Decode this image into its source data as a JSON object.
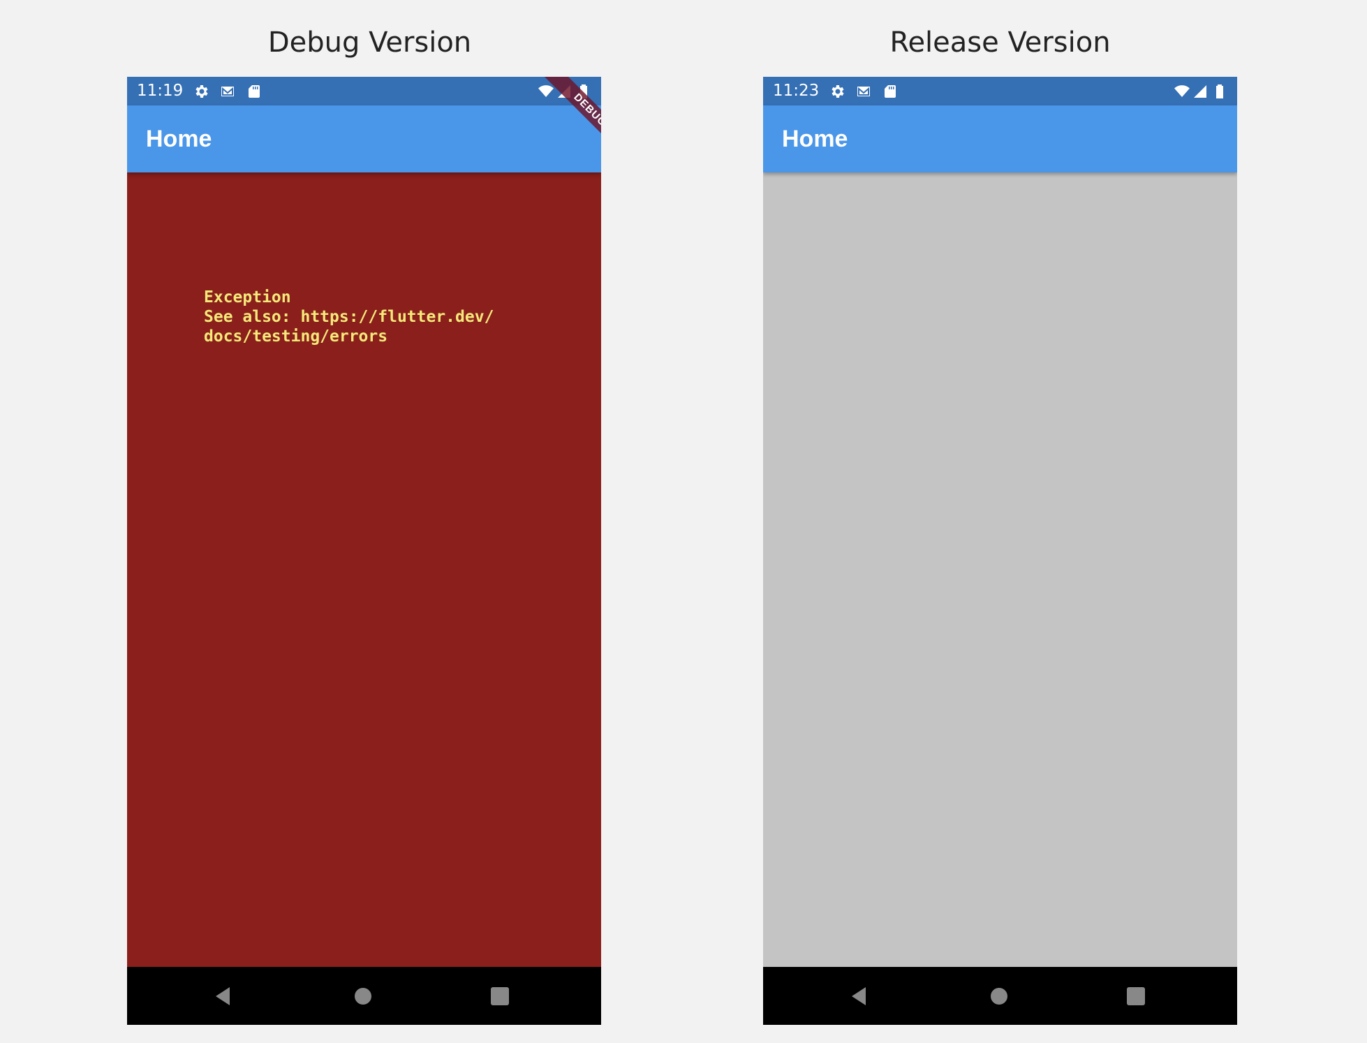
{
  "colors": {
    "page_background": "#f2f2f2",
    "status_bar": "#356fb4",
    "app_bar": "#4a96e8",
    "debug_body": "#8a1f1b",
    "release_body": "#c4c4c4",
    "error_text": "#f5e97a",
    "nav_bar": "#000000",
    "nav_icons": "#888888"
  },
  "debug": {
    "caption": "Debug Version",
    "status_time": "11:19",
    "status_icons_left": [
      "gear-icon",
      "mail-icon",
      "sd-card-icon"
    ],
    "status_icons_right": [
      "wifi-icon",
      "signal-icon",
      "battery-icon"
    ],
    "app_title": "Home",
    "error_message": "Exception\nSee also: https://flutter.dev/\ndocs/testing/errors",
    "banner_label": "DEBUG",
    "nav_icons": [
      "back-icon",
      "home-icon",
      "recents-icon"
    ]
  },
  "release": {
    "caption": "Release Version",
    "status_time": "11:23",
    "status_icons_left": [
      "gear-icon",
      "mail-icon",
      "sd-card-icon"
    ],
    "status_icons_right": [
      "wifi-icon",
      "signal-icon",
      "battery-icon"
    ],
    "app_title": "Home",
    "nav_icons": [
      "back-icon",
      "home-icon",
      "recents-icon"
    ]
  }
}
